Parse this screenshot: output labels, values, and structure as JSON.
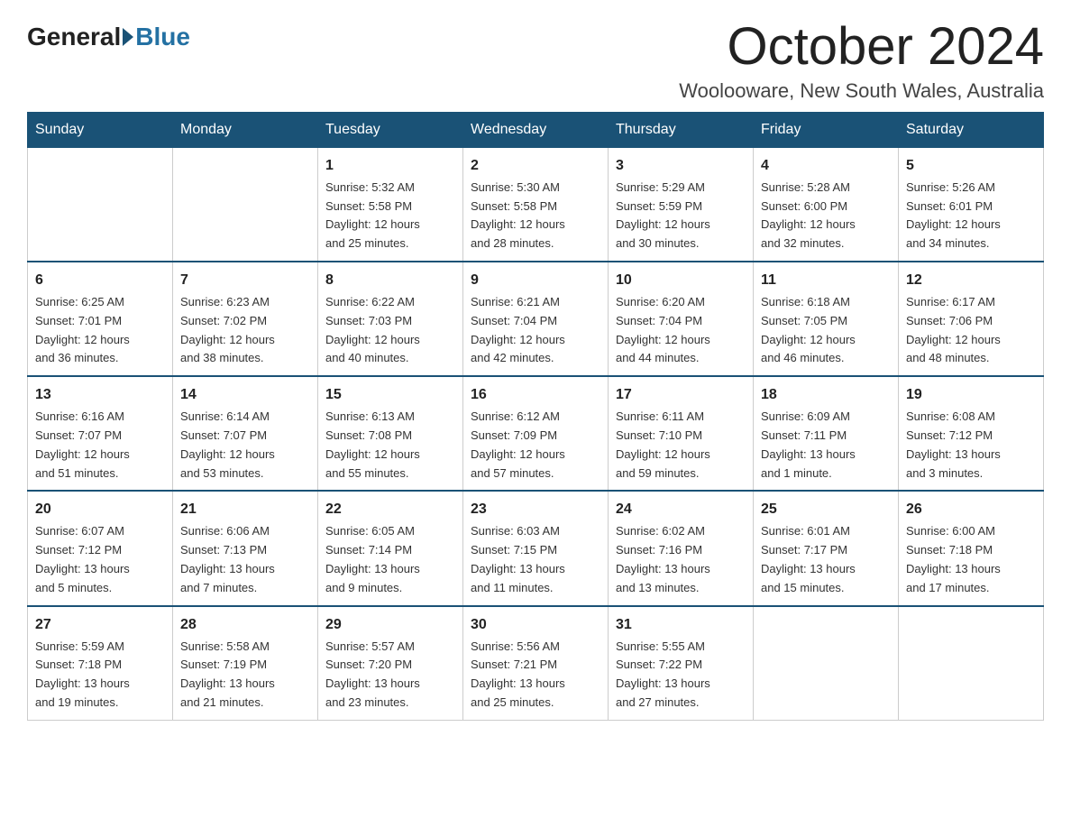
{
  "header": {
    "logo_general": "General",
    "logo_blue": "Blue",
    "month_title": "October 2024",
    "location": "Woolooware, New South Wales, Australia"
  },
  "weekdays": [
    "Sunday",
    "Monday",
    "Tuesday",
    "Wednesday",
    "Thursday",
    "Friday",
    "Saturday"
  ],
  "weeks": [
    [
      {
        "day": "",
        "info": ""
      },
      {
        "day": "",
        "info": ""
      },
      {
        "day": "1",
        "info": "Sunrise: 5:32 AM\nSunset: 5:58 PM\nDaylight: 12 hours\nand 25 minutes."
      },
      {
        "day": "2",
        "info": "Sunrise: 5:30 AM\nSunset: 5:58 PM\nDaylight: 12 hours\nand 28 minutes."
      },
      {
        "day": "3",
        "info": "Sunrise: 5:29 AM\nSunset: 5:59 PM\nDaylight: 12 hours\nand 30 minutes."
      },
      {
        "day": "4",
        "info": "Sunrise: 5:28 AM\nSunset: 6:00 PM\nDaylight: 12 hours\nand 32 minutes."
      },
      {
        "day": "5",
        "info": "Sunrise: 5:26 AM\nSunset: 6:01 PM\nDaylight: 12 hours\nand 34 minutes."
      }
    ],
    [
      {
        "day": "6",
        "info": "Sunrise: 6:25 AM\nSunset: 7:01 PM\nDaylight: 12 hours\nand 36 minutes."
      },
      {
        "day": "7",
        "info": "Sunrise: 6:23 AM\nSunset: 7:02 PM\nDaylight: 12 hours\nand 38 minutes."
      },
      {
        "day": "8",
        "info": "Sunrise: 6:22 AM\nSunset: 7:03 PM\nDaylight: 12 hours\nand 40 minutes."
      },
      {
        "day": "9",
        "info": "Sunrise: 6:21 AM\nSunset: 7:04 PM\nDaylight: 12 hours\nand 42 minutes."
      },
      {
        "day": "10",
        "info": "Sunrise: 6:20 AM\nSunset: 7:04 PM\nDaylight: 12 hours\nand 44 minutes."
      },
      {
        "day": "11",
        "info": "Sunrise: 6:18 AM\nSunset: 7:05 PM\nDaylight: 12 hours\nand 46 minutes."
      },
      {
        "day": "12",
        "info": "Sunrise: 6:17 AM\nSunset: 7:06 PM\nDaylight: 12 hours\nand 48 minutes."
      }
    ],
    [
      {
        "day": "13",
        "info": "Sunrise: 6:16 AM\nSunset: 7:07 PM\nDaylight: 12 hours\nand 51 minutes."
      },
      {
        "day": "14",
        "info": "Sunrise: 6:14 AM\nSunset: 7:07 PM\nDaylight: 12 hours\nand 53 minutes."
      },
      {
        "day": "15",
        "info": "Sunrise: 6:13 AM\nSunset: 7:08 PM\nDaylight: 12 hours\nand 55 minutes."
      },
      {
        "day": "16",
        "info": "Sunrise: 6:12 AM\nSunset: 7:09 PM\nDaylight: 12 hours\nand 57 minutes."
      },
      {
        "day": "17",
        "info": "Sunrise: 6:11 AM\nSunset: 7:10 PM\nDaylight: 12 hours\nand 59 minutes."
      },
      {
        "day": "18",
        "info": "Sunrise: 6:09 AM\nSunset: 7:11 PM\nDaylight: 13 hours\nand 1 minute."
      },
      {
        "day": "19",
        "info": "Sunrise: 6:08 AM\nSunset: 7:12 PM\nDaylight: 13 hours\nand 3 minutes."
      }
    ],
    [
      {
        "day": "20",
        "info": "Sunrise: 6:07 AM\nSunset: 7:12 PM\nDaylight: 13 hours\nand 5 minutes."
      },
      {
        "day": "21",
        "info": "Sunrise: 6:06 AM\nSunset: 7:13 PM\nDaylight: 13 hours\nand 7 minutes."
      },
      {
        "day": "22",
        "info": "Sunrise: 6:05 AM\nSunset: 7:14 PM\nDaylight: 13 hours\nand 9 minutes."
      },
      {
        "day": "23",
        "info": "Sunrise: 6:03 AM\nSunset: 7:15 PM\nDaylight: 13 hours\nand 11 minutes."
      },
      {
        "day": "24",
        "info": "Sunrise: 6:02 AM\nSunset: 7:16 PM\nDaylight: 13 hours\nand 13 minutes."
      },
      {
        "day": "25",
        "info": "Sunrise: 6:01 AM\nSunset: 7:17 PM\nDaylight: 13 hours\nand 15 minutes."
      },
      {
        "day": "26",
        "info": "Sunrise: 6:00 AM\nSunset: 7:18 PM\nDaylight: 13 hours\nand 17 minutes."
      }
    ],
    [
      {
        "day": "27",
        "info": "Sunrise: 5:59 AM\nSunset: 7:18 PM\nDaylight: 13 hours\nand 19 minutes."
      },
      {
        "day": "28",
        "info": "Sunrise: 5:58 AM\nSunset: 7:19 PM\nDaylight: 13 hours\nand 21 minutes."
      },
      {
        "day": "29",
        "info": "Sunrise: 5:57 AM\nSunset: 7:20 PM\nDaylight: 13 hours\nand 23 minutes."
      },
      {
        "day": "30",
        "info": "Sunrise: 5:56 AM\nSunset: 7:21 PM\nDaylight: 13 hours\nand 25 minutes."
      },
      {
        "day": "31",
        "info": "Sunrise: 5:55 AM\nSunset: 7:22 PM\nDaylight: 13 hours\nand 27 minutes."
      },
      {
        "day": "",
        "info": ""
      },
      {
        "day": "",
        "info": ""
      }
    ]
  ]
}
